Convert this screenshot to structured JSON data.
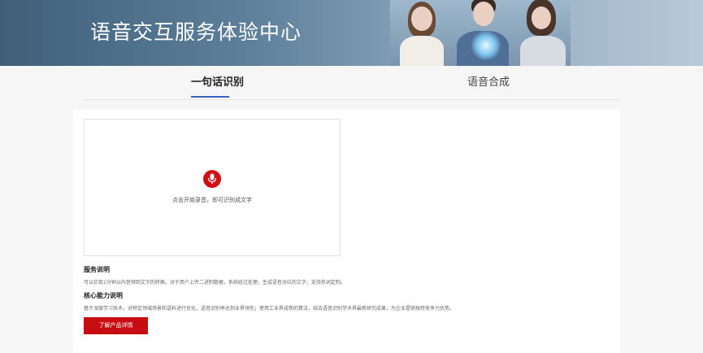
{
  "banner": {
    "title": "语音交互服务体验中心"
  },
  "tabs": [
    {
      "label": "一句话识别",
      "active": true
    },
    {
      "label": "语音合成",
      "active": false
    }
  ],
  "recorder": {
    "hint": "点击开始录音，即可识别成文字",
    "icon": "microphone-icon"
  },
  "service": {
    "title": "服务说明",
    "desc": "可以实现1分钟以内音频到文字的转换。对于用户上传二进制数据，系统经过处理，生成语音对应的文字，支持热词定制。"
  },
  "capability": {
    "title": "核心能力说明",
    "desc": "基于深度学习技术，对特定领域场景和语料进行优化，语音识别率达到业界领先；使用工业界成熟的算法，结合语音识别学术界最新研究成果，为企业提供独特竞争力优势。"
  },
  "cta": {
    "label": "了解产品详情"
  },
  "colors": {
    "accent": "#c70d12",
    "tab_underline": "#3264c0"
  }
}
